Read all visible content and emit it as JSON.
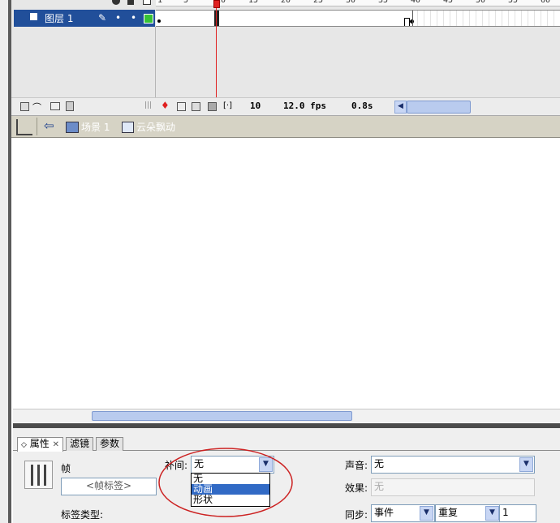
{
  "timeline": {
    "ruler_numbers": [
      "1",
      "5",
      "10",
      "15",
      "20",
      "25",
      "30",
      "35",
      "40",
      "45",
      "50",
      "55",
      "60"
    ],
    "layer": {
      "name": "图层 1"
    },
    "status": {
      "current_frame": "10",
      "frame_rate": "12.0 fps",
      "elapsed": "0.8s"
    }
  },
  "breadcrumb": {
    "scene": "场景 1",
    "symbol": "云朵飘动"
  },
  "properties": {
    "tabs": [
      "属性",
      "滤镜",
      "参数"
    ],
    "frame_label": "帧",
    "frame_name_placeholder": "<帧标签>",
    "label_type": "标签类型:",
    "tween_label": "补间:",
    "tween_value": "无",
    "tween_options": [
      "无",
      "动画",
      "形状"
    ],
    "tween_selected": "动画",
    "sound_label": "声音:",
    "sound_value": "无",
    "effect_label": "效果:",
    "effect_value": "无",
    "sync_label": "同步:",
    "sync_value": "事件",
    "repeat_value": "重复",
    "repeat_count": "1"
  },
  "colors": {
    "selection": "#214f9a",
    "playhead": "#e02020",
    "annotation": "#cc2222"
  }
}
